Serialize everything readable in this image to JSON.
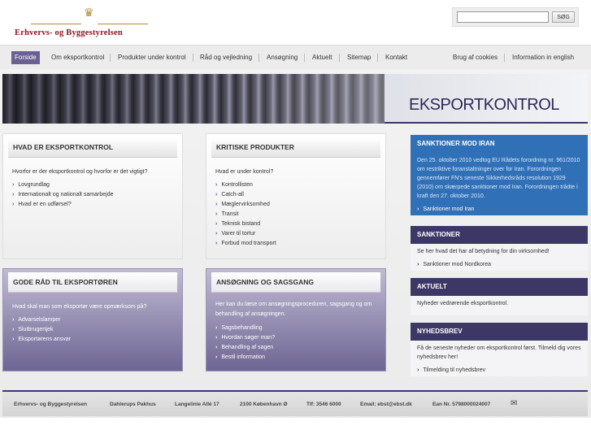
{
  "logo": {
    "name": "Erhvervs- og Byggestyrelsen",
    "crown": "♛"
  },
  "search": {
    "value": "",
    "placeholder": "",
    "button": "SØG"
  },
  "nav": {
    "items": [
      "Forside",
      "Om eksportkontrol",
      "Produkter under kontrol",
      "Råd og vejledning",
      "Ansøgning",
      "Aktuelt",
      "Sitemap",
      "Kontakt"
    ],
    "right": [
      "Brug af cookies",
      "Information in english"
    ]
  },
  "banner": {
    "title": "EKSPORTKONTROL"
  },
  "boxes": {
    "what": {
      "title": "HVAD ER EKSPORTKONTROL",
      "intro": "Hvorfor er der eksportkontrol og hvorfor er det vigtigt?",
      "links": [
        "Lovgrundlag",
        "Internationalt og nationalt samarbejde",
        "Hvad er en udførsel?"
      ]
    },
    "critical": {
      "title": "KRITISKE PRODUKTER",
      "intro": "Hvad er under kontrol?",
      "links": [
        "Kontrollisten",
        "Catch-all",
        "Mæglervirksomhed",
        "Transit",
        "Teknisk bistand",
        "Varer til tortur",
        "Forbud mod transport"
      ]
    },
    "advice": {
      "title": "GODE RÅD TIL EKSPORTØREN",
      "intro": "Hvad skal man som eksportør være opmærksom på?",
      "links": [
        "Advarselslamper",
        "Slutbrugertjek",
        "Eksportørens ansvar"
      ]
    },
    "apply": {
      "title": "ANSØGNING OG SAGSGANG",
      "intro": "Her kan du læse om ansøgningsproceduren, sagsgang og om behandling af ansøgningen.",
      "links": [
        "Sagsbehandling",
        "Hvordan søger man?",
        "Behandling af sagen",
        "Bestil information"
      ]
    }
  },
  "sidebar": {
    "iran": {
      "title": "SANKTIONER MOD IRAN",
      "text": "Den 25. oktober 2010 vedtog EU Rådets forordning nr. 961/2010 om restriktive foranstaltninger over for Iran. Forordningen gennemfører FN's seneste Sikkerhedsråds resolution 1929 (2010) om skærpede sanktioner mod Iran. Forordningen trådte i kraft den 27. oktober 2010.",
      "link": "Sanktioner mod Iran"
    },
    "sanctions": {
      "title": "SANKTIONER",
      "text": "Se her hvad det har af betydning for din virksomhed!",
      "link": "Sanktioner mod Nordkorea"
    },
    "news": {
      "title": "AKTUELT",
      "text": "Nyheder vedrørende eksportkontrol."
    },
    "newsletter": {
      "title": "NYHEDSBREV",
      "text": "Få de seneste nyheder om eksportkontrol først. Tilmeld dig vores nyhedsbrev her!",
      "link": "Tilmelding til nyhedsbrev"
    }
  },
  "footer": {
    "items": [
      "Erhvervs- og Byggestyrelsen",
      "Dahlerups Pakhus",
      "Langelinie Allé 17",
      "2100 København Ø",
      "Tlf: 3546 6000",
      "Email: ebst@ebst.dk",
      "Ean Nr. 5798000024007"
    ],
    "icon": "✉"
  },
  "colors": {
    "brand_purple": "#3d3766",
    "brand_red": "#8a1520",
    "accent_blue": "#2f70b6"
  }
}
